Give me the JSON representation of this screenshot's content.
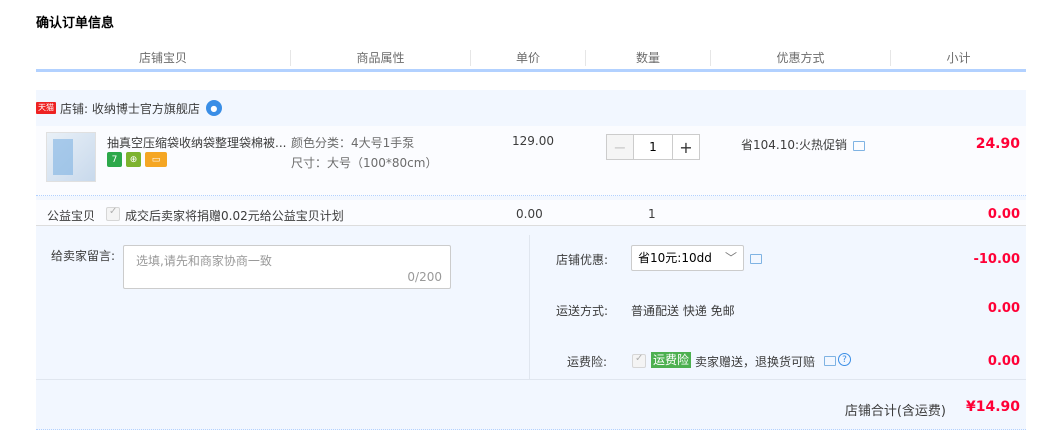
{
  "title": "确认订单信息",
  "columns": [
    "店铺宝贝",
    "商品属性",
    "单价",
    "数量",
    "优惠方式",
    "小计"
  ],
  "shop": {
    "badge": "天猫",
    "label": "店铺: 收纳博士官方旗舰店"
  },
  "item": {
    "title": "抽真空压缩袋收纳袋整理袋棉被...",
    "attr_color": "颜色分类：4大号1手泵",
    "attr_size": "尺寸：大号（100*80cm）",
    "price": "129.00",
    "quantity": "1",
    "minus": "−",
    "plus": "+",
    "promo": "省104.10:火热促销",
    "subtotal": "24.90",
    "badges": [
      "7",
      "⊕",
      "▭"
    ]
  },
  "charity": {
    "label": "公益宝贝",
    "text": "成交后卖家将捐赠0.02元给公益宝贝计划",
    "price": "0.00",
    "quantity": "1",
    "amount": "0.00"
  },
  "memo": {
    "label": "给卖家留言:",
    "placeholder": "选填,请先和商家协商一致",
    "counter": "0/200"
  },
  "shop_discount": {
    "label": "店铺优惠:",
    "selected": "省10元:10dd",
    "amount": "-10.00"
  },
  "shipping": {
    "label": "运送方式:",
    "value": "普通配送 快递 免邮",
    "amount": "0.00"
  },
  "insurance": {
    "label": "运费险:",
    "tag": "运费险",
    "text": "卖家赠送，退换货可赔",
    "amount": "0.00"
  },
  "total": {
    "label": "店铺合计(含运费)",
    "amount": "¥14.90"
  },
  "colors": {
    "accent_red": "#ff0036",
    "header_rule": "#b2d1ff",
    "panel_bg": "#f2f7ff"
  }
}
